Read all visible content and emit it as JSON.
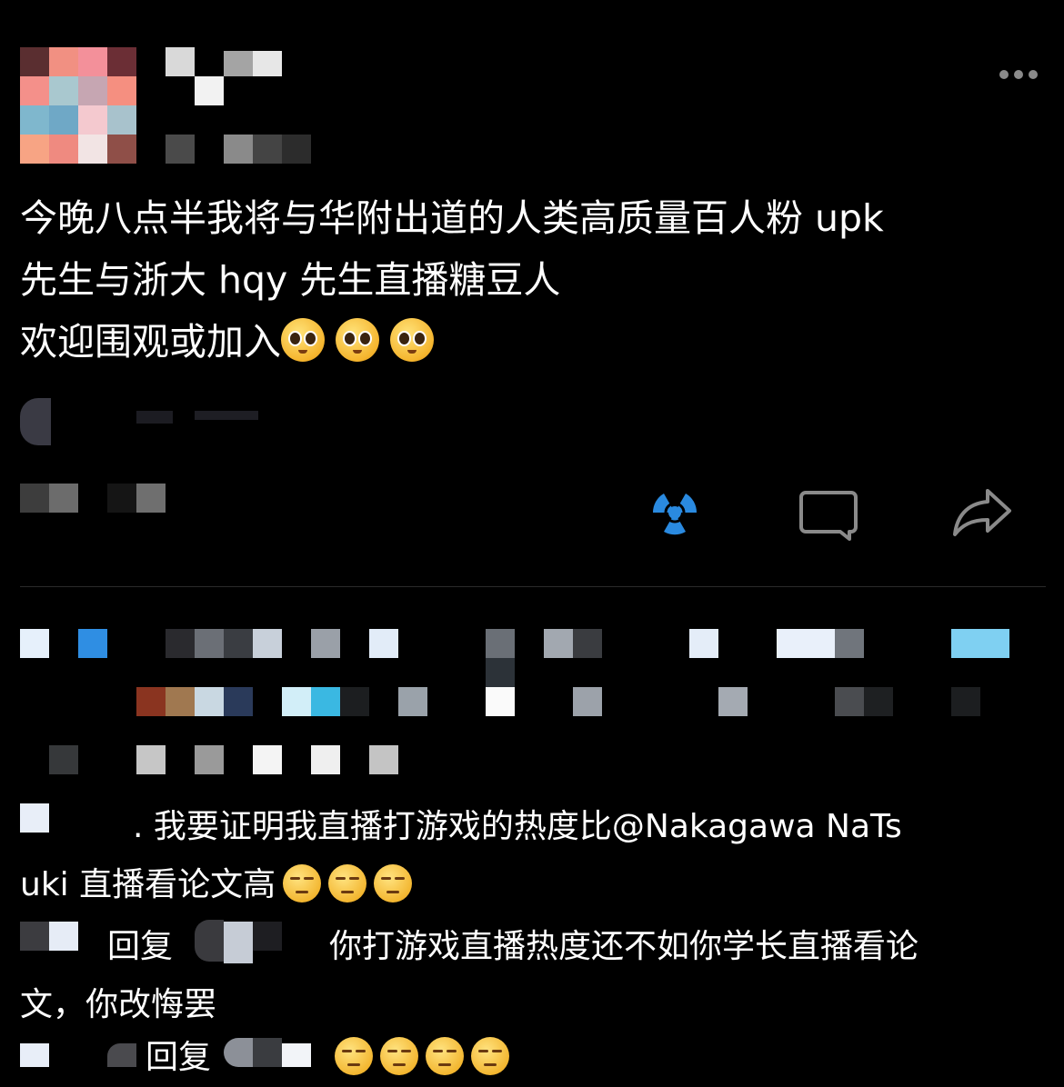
{
  "post": {
    "text_line1": "今晚八点半我将与华附出道的人类高质量百人粉 upk",
    "text_line2": "先生与浙大 hqy 先生直播糖豆人",
    "text_line3": "欢迎围观或加入",
    "emoji_icons": [
      "pleading-face-icon",
      "pleading-face-icon",
      "pleading-face-icon"
    ]
  },
  "actions": {
    "like_icon": "radioactive-like-icon",
    "comment_icon": "comment-icon",
    "share_icon": "share-icon",
    "more_icon": "more-icon"
  },
  "comments": [
    {
      "prefix": ". 我要证明我直播打游戏的热度比@Nakagawa NaTs",
      "continuation": "uki 直播看论文高",
      "emoji_icons": [
        "relieved-face-icon",
        "relieved-face-icon",
        "relieved-face-icon"
      ]
    },
    {
      "reply_word": "回复",
      "text": "你打游戏直播热度还不如你学长直播看论",
      "continuation": "文，你改悔罢"
    },
    {
      "reply_word": "回复",
      "emoji_icons": [
        "unamused-face-icon",
        "unamused-face-icon",
        "unamused-face-icon",
        "unamused-face-icon"
      ]
    }
  ],
  "colors": {
    "background": "#000000",
    "text": "#ffffff",
    "like_blue": "#2a8ae0",
    "icon_gray": "#8a8a8a"
  }
}
